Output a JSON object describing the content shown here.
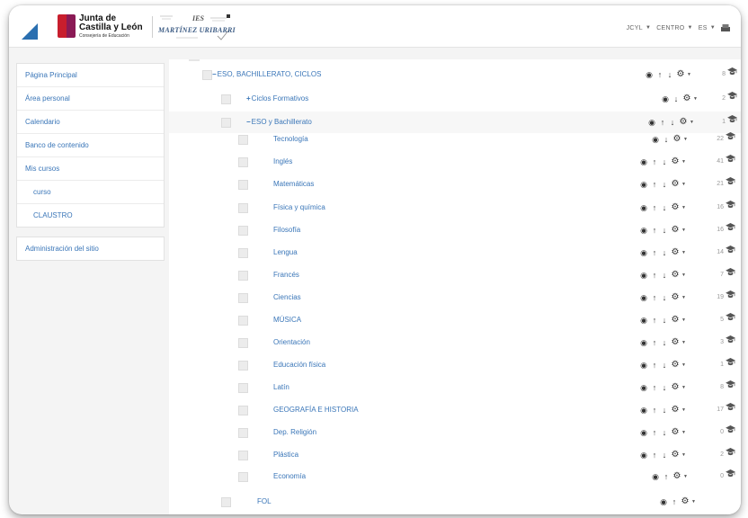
{
  "header": {
    "jcyl_line1": "Junta de",
    "jcyl_line2": "Castilla y León",
    "jcyl_line3": "Consejería de Educación",
    "ies_line1": "IES",
    "ies_line2": "MARTÍNEZ URIBARRI",
    "menu": [
      {
        "label": "JCYL"
      },
      {
        "label": "CENTRO"
      },
      {
        "label": "ES"
      }
    ]
  },
  "sidebar": {
    "nav": [
      {
        "label": "Página Principal"
      },
      {
        "label": "Área personal"
      },
      {
        "label": "Calendario"
      },
      {
        "label": "Banco de contenido"
      },
      {
        "label": "Mis cursos"
      },
      {
        "label": "curso"
      },
      {
        "label": "CLAUSTRO"
      }
    ],
    "admin": [
      {
        "label": "Administración del sitio"
      }
    ]
  },
  "categories": [
    {
      "sign": "−",
      "label": "ESO, BACHILLERATO, CICLOS",
      "count": "8",
      "up": true,
      "down": true
    },
    {
      "sign": "+",
      "label": "Ciclos Formativos",
      "count": "2",
      "up": false,
      "down": true
    },
    {
      "sign": "−",
      "label": "ESO y Bachillerato",
      "count": "1",
      "up": true,
      "down": true
    },
    {
      "sign": "",
      "label": "Tecnología",
      "count": "22",
      "up": false,
      "down": true
    },
    {
      "sign": "",
      "label": "Inglés",
      "count": "41",
      "up": true,
      "down": true
    },
    {
      "sign": "",
      "label": "Matemáticas",
      "count": "21",
      "up": true,
      "down": true
    },
    {
      "sign": "",
      "label": "Física y química",
      "count": "16",
      "up": true,
      "down": true
    },
    {
      "sign": "",
      "label": "Filosofía",
      "count": "16",
      "up": true,
      "down": true
    },
    {
      "sign": "",
      "label": "Lengua",
      "count": "14",
      "up": true,
      "down": true
    },
    {
      "sign": "",
      "label": "Francés",
      "count": "7",
      "up": true,
      "down": true
    },
    {
      "sign": "",
      "label": "Ciencias",
      "count": "19",
      "up": true,
      "down": true
    },
    {
      "sign": "",
      "label": "MÚSICA",
      "count": "5",
      "up": true,
      "down": true
    },
    {
      "sign": "",
      "label": "Orientación",
      "count": "3",
      "up": true,
      "down": true
    },
    {
      "sign": "",
      "label": "Educación física",
      "count": "1",
      "up": true,
      "down": true
    },
    {
      "sign": "",
      "label": "Latín",
      "count": "8",
      "up": true,
      "down": true
    },
    {
      "sign": "",
      "label": "GEOGRAFÍA E HISTORIA",
      "count": "17",
      "up": true,
      "down": true
    },
    {
      "sign": "",
      "label": "Dep. Religión",
      "count": "0",
      "up": true,
      "down": true
    },
    {
      "sign": "",
      "label": "Plástica",
      "count": "2",
      "up": true,
      "down": true
    },
    {
      "sign": "",
      "label": "Economía",
      "count": "0",
      "up": true,
      "down": false
    },
    {
      "sign": "",
      "label": "FOL",
      "count": "",
      "up": true,
      "down": false
    }
  ]
}
